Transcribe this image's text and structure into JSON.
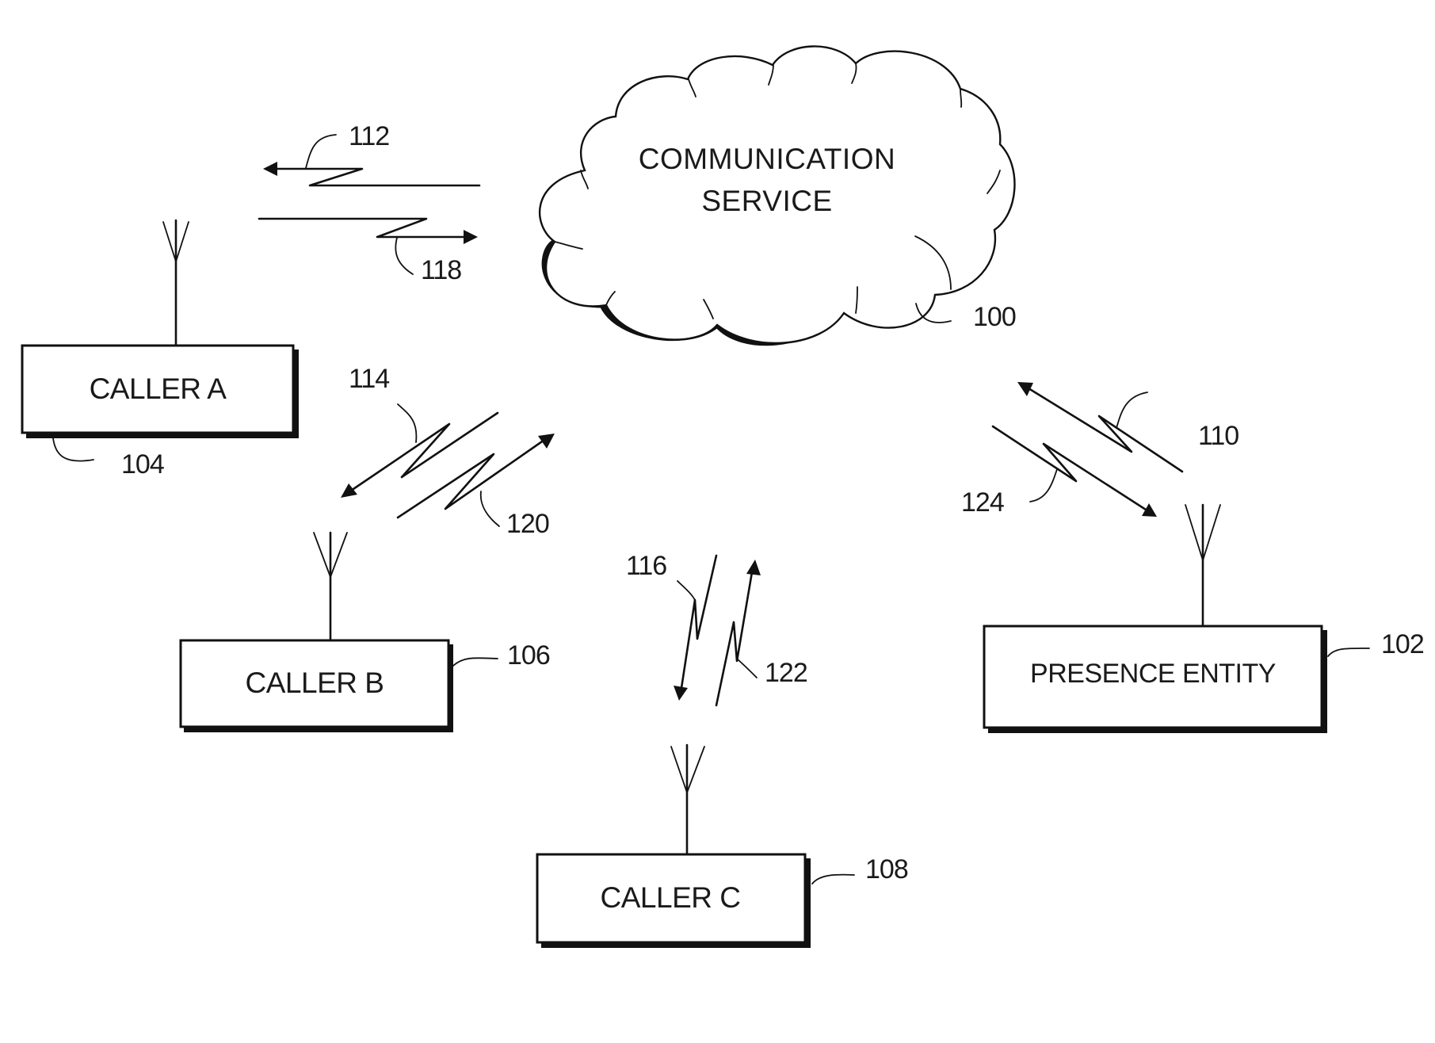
{
  "figure": {
    "cloud": {
      "label_line1": "COMMUNICATION",
      "label_line2": "SERVICE",
      "ref": "100"
    },
    "nodes": [
      {
        "id": "caller-a",
        "label": "CALLER A",
        "ref": "104"
      },
      {
        "id": "caller-b",
        "label": "CALLER B",
        "ref": "106"
      },
      {
        "id": "caller-c",
        "label": "CALLER C",
        "ref": "108"
      },
      {
        "id": "presence-entity",
        "label": "PRESENCE ENTITY",
        "ref": "102"
      }
    ],
    "signals": [
      {
        "ref": "112",
        "from": "communication-service",
        "to": "caller-a"
      },
      {
        "ref": "118",
        "from": "caller-a",
        "to": "communication-service"
      },
      {
        "ref": "114",
        "from": "communication-service",
        "to": "caller-b"
      },
      {
        "ref": "120",
        "from": "caller-b",
        "to": "communication-service"
      },
      {
        "ref": "116",
        "from": "communication-service",
        "to": "caller-c"
      },
      {
        "ref": "122",
        "from": "caller-c",
        "to": "communication-service"
      },
      {
        "ref": "110",
        "from": "presence-entity",
        "to": "communication-service"
      },
      {
        "ref": "124",
        "from": "communication-service",
        "to": "presence-entity"
      }
    ]
  }
}
